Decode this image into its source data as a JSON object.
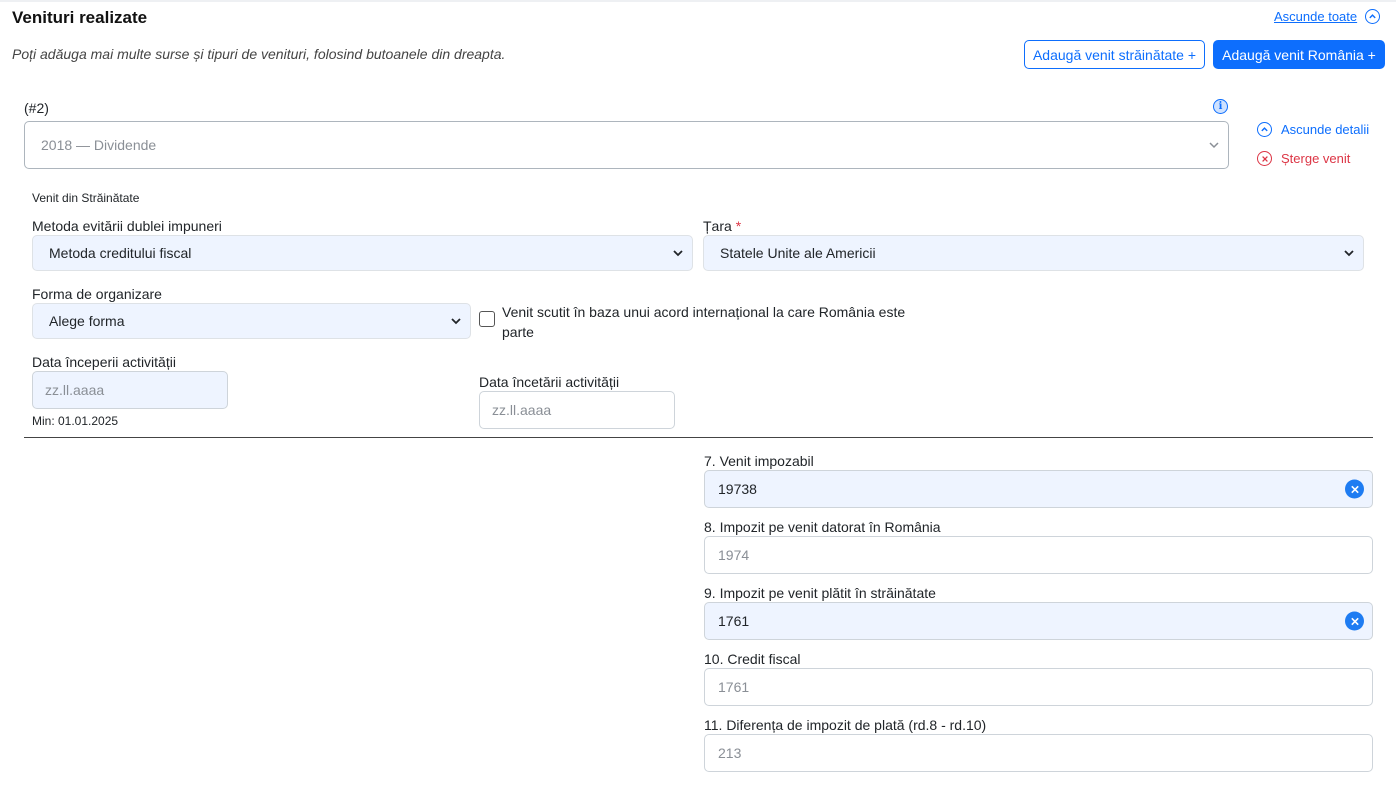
{
  "section": {
    "title": "Venituri realizate",
    "subtitle": "Poți adăuga mai multe surse și tipuri de venituri, folosind butoanele din dreapta.",
    "collapse_all_label": "Ascunde toate",
    "add_foreign_label": "Adaugă venit străinătate +",
    "add_romania_label": "Adaugă venit România +"
  },
  "income_entry": {
    "index_label": "(#2)",
    "selected_income": "2018 — Dividende",
    "hide_details_label": "Ascunde detalii",
    "delete_label": "Șterge venit",
    "group_label": "Venit din Străinătate",
    "method": {
      "label": "Metoda evitării dublei impuneri",
      "value": "Metoda creditului fiscal"
    },
    "country": {
      "label": "Țara",
      "required_mark": "*",
      "value": "Statele Unite ale Americii"
    },
    "organization": {
      "label": "Forma de organizare",
      "value": "Alege forma"
    },
    "exempt_checkbox": {
      "label": "Venit scutit în baza unui acord internațional la care România este parte",
      "checked": false
    },
    "start_date": {
      "label": "Data începerii activității",
      "placeholder": "zz.ll.aaaa",
      "hint": "Min: 01.01.2025"
    },
    "end_date": {
      "label": "Data încetării activității",
      "placeholder": "zz.ll.aaaa"
    }
  },
  "calculations": [
    {
      "label": "7. Venit impozabil",
      "value": "19738",
      "editable": true
    },
    {
      "label": "8. Impozit pe venit datorat în România",
      "value": "1974",
      "editable": false
    },
    {
      "label": "9. Impozit pe venit plătit în străinătate",
      "value": "1761",
      "editable": true
    },
    {
      "label": "10. Credit fiscal",
      "value": "1761",
      "editable": false
    },
    {
      "label": "11. Diferența de impozit de plată (rd.8 - rd.10)",
      "value": "213",
      "editable": false
    }
  ],
  "colors": {
    "primary": "#0d6efd",
    "danger": "#dc3545",
    "filled_bg": "#eef4ff"
  }
}
